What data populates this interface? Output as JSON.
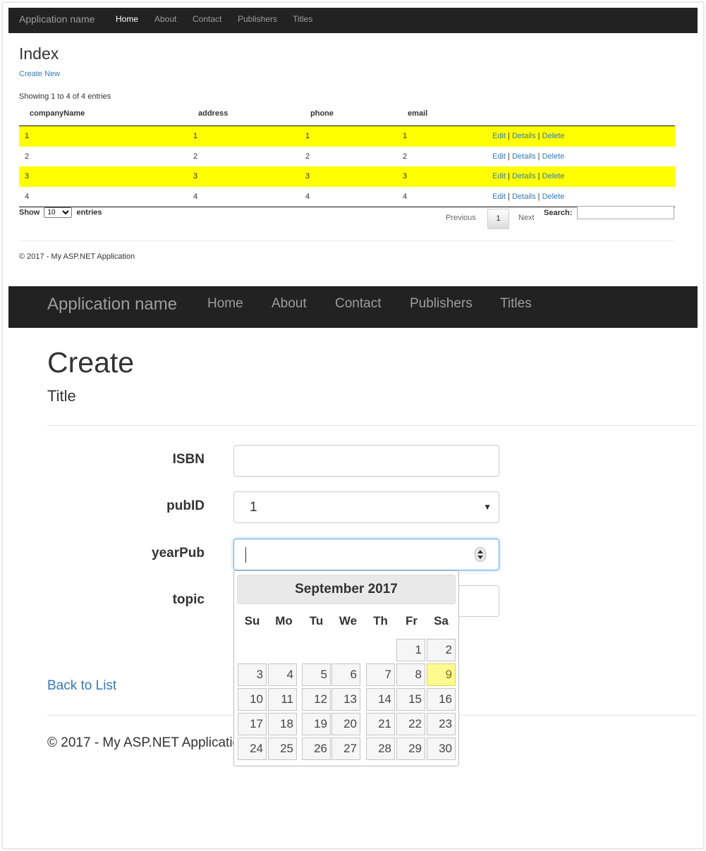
{
  "top": {
    "nav": {
      "brand": "Application name",
      "items": [
        "Home",
        "About",
        "Contact",
        "Publishers",
        "Titles"
      ]
    },
    "title": "Index",
    "create_link": "Create New",
    "info": "Showing 1 to 4 of 4 entries",
    "columns": [
      "companyName",
      "address",
      "phone",
      "email"
    ],
    "rows": [
      [
        "1",
        "1",
        "1",
        "1"
      ],
      [
        "2",
        "2",
        "2",
        "2"
      ],
      [
        "3",
        "3",
        "3",
        "3"
      ],
      [
        "4",
        "4",
        "4",
        "4"
      ]
    ],
    "actions": {
      "edit": "Edit",
      "details": "Details",
      "delete": "Delete",
      "sep": "|"
    },
    "show_label": "Show",
    "show_value": "10",
    "entries_label": "entries",
    "pager": {
      "previous": "Previous",
      "page": "1",
      "next": "Next"
    },
    "search_label": "Search:",
    "footer": "© 2017 - My ASP.NET Application"
  },
  "bottom": {
    "nav": {
      "brand": "Application name",
      "items": [
        "Home",
        "About",
        "Contact",
        "Publishers",
        "Titles"
      ]
    },
    "title": "Create",
    "subtitle": "Title",
    "fields": {
      "isbn": {
        "label": "ISBN",
        "value": ""
      },
      "pubid": {
        "label": "pubID",
        "value": "1"
      },
      "yearpub": {
        "label": "yearPub",
        "value": ""
      },
      "topic": {
        "label": "topic",
        "value": ""
      }
    },
    "back_link": "Back to List",
    "footer": "© 2017 - My ASP.NET Application"
  },
  "datepicker": {
    "month_title": "September 2017",
    "weekdays": [
      "Su",
      "Mo",
      "Tu",
      "We",
      "Th",
      "Fr",
      "Sa"
    ],
    "first_weekday_index": 5,
    "days": 30,
    "highlighted_day": 9
  },
  "colors": {
    "navbar": "#222222",
    "nav_text": "#9d9d9d",
    "link": "#337ab7",
    "row_highlight": "#ffff00",
    "today_highlight": "#fffa90"
  }
}
